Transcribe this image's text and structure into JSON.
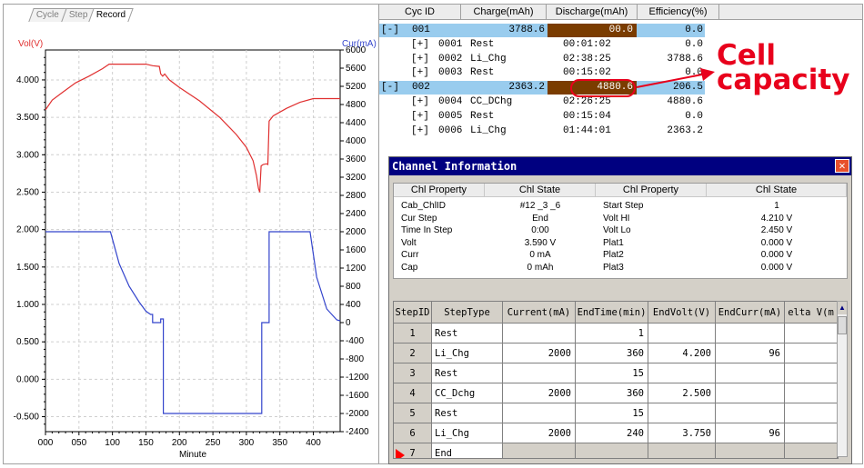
{
  "tabs": [
    "Cycle",
    "Step",
    "Record"
  ],
  "active_tab": "Record",
  "colors": {
    "voltage": "#e03030",
    "current": "#3344cc",
    "selected_row": "#99ccee",
    "discharge_highlight": "#7a3c00",
    "annotation": "#e8001c",
    "dialog_title": "#000080"
  },
  "chart_data": {
    "type": "line",
    "xlabel": "Minute",
    "left_axis_label": "Vol(V)",
    "right_axis_label": "Cur(mA)",
    "xlim": [
      0,
      440
    ],
    "y_left_lim": [
      -0.7,
      4.4
    ],
    "y_right_lim": [
      -2400,
      6000
    ],
    "x_ticks": [
      "000",
      "050",
      "100",
      "150",
      "200",
      "250",
      "300",
      "350",
      "400"
    ],
    "y_left_ticks": [
      "4.000",
      "3.500",
      "3.000",
      "2.500",
      "2.000",
      "1.500",
      "1.000",
      "0.500",
      "0.000",
      "-0.500"
    ],
    "y_right_ticks": [
      "6000",
      "5600",
      "5200",
      "4800",
      "4400",
      "4000",
      "3600",
      "3200",
      "2800",
      "2400",
      "2000",
      "1600",
      "1200",
      "800",
      "400",
      "0",
      "-400",
      "-800",
      "-1200",
      "-1600",
      "-2000",
      "-2400"
    ],
    "grid": true,
    "series": [
      {
        "name": "Vol(V)",
        "axis": "left",
        "x": [
          0,
          10,
          25,
          45,
          65,
          85,
          95,
          120,
          150,
          160,
          170,
          172,
          175,
          178,
          185,
          200,
          230,
          260,
          285,
          300,
          310,
          315,
          318,
          320,
          322,
          325,
          330,
          332,
          334,
          340,
          360,
          380,
          400,
          440
        ],
        "y": [
          3.6,
          3.73,
          3.83,
          3.96,
          4.05,
          4.15,
          4.21,
          4.21,
          4.21,
          4.19,
          4.18,
          4.08,
          4.05,
          4.08,
          4.0,
          3.9,
          3.72,
          3.5,
          3.27,
          3.1,
          2.92,
          2.72,
          2.55,
          2.5,
          2.85,
          2.87,
          2.88,
          2.87,
          3.45,
          3.52,
          3.62,
          3.7,
          3.75,
          3.75
        ]
      },
      {
        "name": "Cur(mA)",
        "axis": "right",
        "x": [
          0,
          97,
          110,
          125,
          140,
          150,
          157,
          160,
          160,
          172,
          172,
          176,
          176,
          323,
          323,
          334,
          334,
          395,
          405,
          420,
          435,
          440
        ],
        "y": [
          2000,
          2000,
          1300,
          800,
          450,
          250,
          180,
          180,
          0,
          0,
          80,
          80,
          -2000,
          -2000,
          0,
          0,
          2000,
          2000,
          1000,
          300,
          60,
          40
        ]
      }
    ]
  },
  "cycle_table": {
    "headers": [
      "Cyc ID",
      "Charge(mAh)",
      "Discharge(mAh)",
      "Efficiency(%)"
    ],
    "rows": [
      {
        "expander": "[-]",
        "id": "001",
        "type": "",
        "charge": "3788.6",
        "time": "",
        "discharge": "00.0",
        "efficiency": "0.0",
        "selected": true,
        "level": 0
      },
      {
        "expander": "[+]",
        "id": "0001",
        "type": "Rest",
        "charge": "",
        "time": "00:01:02",
        "discharge": "",
        "efficiency": "0.0",
        "selected": false,
        "level": 1
      },
      {
        "expander": "[+]",
        "id": "0002",
        "type": "Li_Chg",
        "charge": "",
        "time": "02:38:25",
        "discharge": "",
        "efficiency": "3788.6",
        "selected": false,
        "level": 1
      },
      {
        "expander": "[+]",
        "id": "0003",
        "type": "Rest",
        "charge": "",
        "time": "00:15:02",
        "discharge": "",
        "efficiency": "0.0",
        "selected": false,
        "level": 1
      },
      {
        "expander": "[-]",
        "id": "002",
        "type": "",
        "charge": "2363.2",
        "time": "",
        "discharge": "4880.6",
        "efficiency": "206.5",
        "selected": true,
        "level": 0
      },
      {
        "expander": "[+]",
        "id": "0004",
        "type": "CC_DChg",
        "charge": "",
        "time": "02:26:25",
        "discharge": "",
        "efficiency": "4880.6",
        "selected": false,
        "level": 1
      },
      {
        "expander": "[+]",
        "id": "0005",
        "type": "Rest",
        "charge": "",
        "time": "00:15:04",
        "discharge": "",
        "efficiency": "0.0",
        "selected": false,
        "level": 1
      },
      {
        "expander": "[+]",
        "id": "0006",
        "type": "Li_Chg",
        "charge": "",
        "time": "01:44:01",
        "discharge": "",
        "efficiency": "2363.2",
        "selected": false,
        "level": 1
      }
    ]
  },
  "annotation": {
    "line1": "Cell",
    "line2": "capacity"
  },
  "dialog": {
    "title": "Channel Information",
    "close_symbol": "✕",
    "prop_headers": [
      "Chl Property",
      "Chl State",
      "Chl Property",
      "Chl State"
    ],
    "prop_rows": [
      [
        "Cab_ChlID",
        "#12 _3 _6",
        "Start Step",
        "1"
      ],
      [
        "Cur Step",
        "End",
        "Volt HI",
        "4.210 V"
      ],
      [
        "Time In Step",
        "0:00",
        "Volt Lo",
        "2.450 V"
      ],
      [
        "Volt",
        "3.590 V",
        "Plat1",
        "0.000 V"
      ],
      [
        "Curr",
        "0 mA",
        "Plat2",
        "0.000 V"
      ],
      [
        "Cap",
        "0 mAh",
        "Plat3",
        "0.000 V"
      ]
    ],
    "step_headers": [
      "StepID",
      "StepType",
      "Current(mA)",
      "EndTime(min)",
      "EndVolt(V)",
      "EndCurr(mA)",
      "elta V(m"
    ],
    "step_rows": [
      [
        "1",
        "Rest",
        "",
        "1",
        "",
        "",
        ""
      ],
      [
        "2",
        "Li_Chg",
        "2000",
        "360",
        "4.200",
        "96",
        ""
      ],
      [
        "3",
        "Rest",
        "",
        "15",
        "",
        "",
        ""
      ],
      [
        "4",
        "CC_Dchg",
        "2000",
        "360",
        "2.500",
        "",
        ""
      ],
      [
        "5",
        "Rest",
        "",
        "15",
        "",
        "",
        ""
      ],
      [
        "6",
        "Li_Chg",
        "2000",
        "240",
        "3.750",
        "96",
        ""
      ],
      [
        "7",
        "End",
        "",
        "",
        "",
        "",
        ""
      ]
    ],
    "scroll_up_symbol": "▲"
  }
}
